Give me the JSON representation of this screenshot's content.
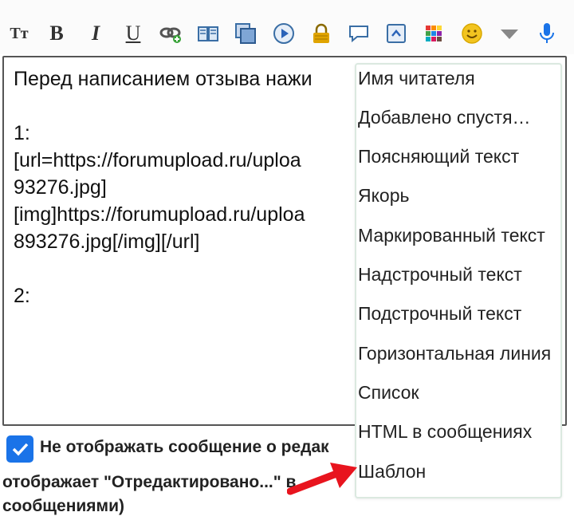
{
  "toolbar": {
    "buttons": [
      {
        "name": "font-size-button",
        "icon": "font-size-icon",
        "glyph": "Tт"
      },
      {
        "name": "bold-button",
        "icon": "bold-icon",
        "glyph": "B"
      },
      {
        "name": "italic-button",
        "icon": "italic-icon",
        "glyph": "I"
      },
      {
        "name": "underline-button",
        "icon": "underline-icon",
        "glyph": "U"
      },
      {
        "name": "link-button",
        "icon": "link-icon"
      },
      {
        "name": "image-button",
        "icon": "book-icon"
      },
      {
        "name": "gallery-button",
        "icon": "gallery-icon"
      },
      {
        "name": "video-button",
        "icon": "play-icon"
      },
      {
        "name": "hide-button",
        "icon": "lock-icon"
      },
      {
        "name": "quote-button",
        "icon": "speech-bubble-icon"
      },
      {
        "name": "code-button",
        "icon": "code-icon"
      },
      {
        "name": "color-button",
        "icon": "color-grid-icon"
      },
      {
        "name": "smiley-button",
        "icon": "smiley-icon"
      },
      {
        "name": "more-button",
        "icon": "triangle-down-icon"
      },
      {
        "name": "voice-button",
        "icon": "microphone-icon"
      }
    ],
    "colors": {
      "accent": "#1a73e8",
      "lock": "#e0a400",
      "smiley": "#f2c420"
    }
  },
  "editor": {
    "text": "Перед написанием отзыва нажи\n\n1:\n[url=https://forumupload.ru/uploa\n93276.jpg]\n[img]https://forumupload.ru/uploa\n893276.jpg[/img][/url]\n\n2:"
  },
  "dropdown": {
    "items": [
      "Имя читателя",
      "Добавлено спустя…",
      "Поясняющий текст",
      "Якорь",
      "Маркированный текст",
      "Надстрочный текст",
      "Подстрочный текст",
      "Горизонтальная линия",
      "Список",
      "HTML в сообщениях",
      "Шаблон"
    ]
  },
  "option": {
    "checked": true,
    "label": "Не отображать сообщение о редак",
    "note_line1": "отображает \"Отредактировано...\" в",
    "note_line2": "сообщениями)"
  },
  "annotation": {
    "arrow_color": "#e8141e"
  }
}
